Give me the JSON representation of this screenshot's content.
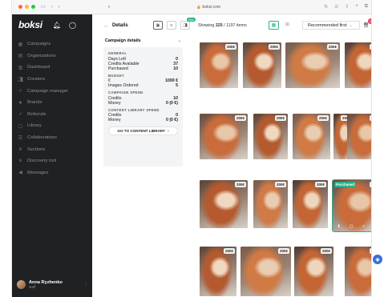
{
  "browser": {
    "url": "boksi.com"
  },
  "sidebar": {
    "logo": "boksi",
    "items": [
      {
        "label": "Campaigns",
        "icon": "grid-icon"
      },
      {
        "label": "Organizations",
        "icon": "building-icon"
      },
      {
        "label": "Dashboard",
        "icon": "chart-icon"
      },
      {
        "label": "Creators",
        "icon": "people-icon"
      },
      {
        "label": "Campaign manager",
        "icon": "check-icon"
      },
      {
        "label": "Brands",
        "icon": "star-icon"
      },
      {
        "label": "Referrals",
        "icon": "check-icon"
      },
      {
        "label": "Library",
        "icon": "library-icon"
      },
      {
        "label": "Collaborations",
        "icon": "list-icon"
      },
      {
        "label": "Sections",
        "icon": "logo-icon"
      },
      {
        "label": "Discovery tool",
        "icon": "logo-icon"
      },
      {
        "label": "Messages",
        "icon": "megaphone-icon"
      }
    ],
    "user": {
      "name": "Anna Ryzhenko",
      "role": "staff"
    }
  },
  "topbar": {
    "back_label": "Details",
    "new_badge": "New",
    "showing_prefix": "Showing",
    "showing_count": "225",
    "showing_suffix": "/ 1197 items",
    "sort_label": "Recommended first",
    "cart_count": "0"
  },
  "details": {
    "title": "Campaign details",
    "general": {
      "title": "GENERAL",
      "rows": [
        {
          "label": "Days Left",
          "value": "0"
        },
        {
          "label": "Credits Available",
          "value": "37"
        },
        {
          "label": "Purchased",
          "value": "10"
        }
      ]
    },
    "budget": {
      "title": "BUDGET",
      "rows": [
        {
          "label": "€",
          "value": "1000 €"
        },
        {
          "label": "Images Ordered",
          "value": "5"
        }
      ]
    },
    "spend": {
      "title": "CAMPAIGN SPEND",
      "rows": [
        {
          "label": "Credits",
          "value": "10"
        },
        {
          "label": "Money",
          "value": "0 (0 €)"
        }
      ]
    },
    "library_spend": {
      "title": "CONTENT LIBRARY SPEND",
      "rows": [
        {
          "label": "Credits",
          "value": "0"
        },
        {
          "label": "Money",
          "value": "0 (0 €)"
        }
      ]
    },
    "goto_button": "GO TO CONTENT LIBRARY"
  },
  "gallery": {
    "price": "200€",
    "purchased_label": "Purchased",
    "tiles": [
      {
        "price": "200€"
      },
      {
        "price": "200€"
      },
      {
        "price": "200€"
      },
      {
        "price": "200€"
      },
      {
        "price": "200€"
      },
      {
        "price": "200€"
      },
      {
        "price": "200€"
      },
      {
        "price": "200€"
      },
      {
        "price": "200€"
      },
      {
        "price": "200€"
      },
      {
        "price": "200€"
      },
      {
        "price": "200€"
      },
      {
        "price": "200€",
        "purchased": true
      },
      {
        "price": "200€"
      },
      {
        "price": "200€"
      },
      {
        "price": "200€"
      },
      {
        "price": "200€"
      }
    ]
  },
  "colors": {
    "accent": "#2bb08a",
    "sidebar_bg": "#1f2123",
    "cart_badge": "#f03e5e"
  }
}
